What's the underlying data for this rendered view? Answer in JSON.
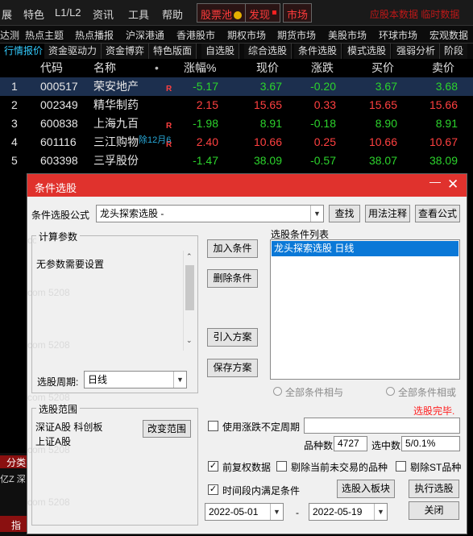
{
  "menubar": {
    "items": [
      "展",
      "特色",
      "L1/L2",
      "资讯",
      "工具",
      "帮助"
    ],
    "stock_pool": "股票池",
    "discover": "发现",
    "market": "市场",
    "marquee": "应股本数据 临时数据"
  },
  "navbar": {
    "items": [
      "达测",
      "热点主题",
      "热点播报",
      "沪深港通",
      "香港股市",
      "期权市场",
      "期货市场",
      "美股市场",
      "环球市场",
      "宏观数据"
    ]
  },
  "tabs": {
    "items": [
      "行情报价",
      "资金驱动力",
      "资金博弈",
      "特色版面",
      "自选股",
      "综合选股",
      "条件选股",
      "模式选股",
      "强弱分析",
      "阶段"
    ],
    "active": "行情报价"
  },
  "grid": {
    "headers": [
      "",
      "代码",
      "名称",
      "•",
      "涨幅%",
      "现价",
      "涨跌",
      "买价",
      "卖价"
    ],
    "rows": [
      {
        "idx": "1",
        "code": "000517",
        "name": "荣安地产",
        "flag": "R",
        "pct": "-5.17",
        "price": "3.67",
        "chg": "-0.20",
        "bid": "3.67",
        "ask": "3.68"
      },
      {
        "idx": "2",
        "code": "002349",
        "name": "精华制药",
        "flag": "",
        "pct": "2.15",
        "price": "15.65",
        "chg": "0.33",
        "bid": "15.65",
        "ask": "15.66"
      },
      {
        "idx": "3",
        "code": "600838",
        "name": "上海九百",
        "flag": "R",
        "pct": "-1.98",
        "price": "8.91",
        "chg": "-0.18",
        "bid": "8.90",
        "ask": "8.91"
      },
      {
        "idx": "4",
        "code": "601116",
        "name": "三江购物",
        "flag": "R",
        "pct": "2.40",
        "price": "10.66",
        "chg": "0.25",
        "bid": "10.66",
        "ask": "10.67"
      },
      {
        "idx": "5",
        "code": "603398",
        "name": "三孚股份",
        "flag": "",
        "pct": "-1.47",
        "price": "38.09",
        "chg": "-0.57",
        "bid": "38.07",
        "ask": "38.09"
      }
    ],
    "tooltip": "除12月6"
  },
  "dialog": {
    "title": "条件选股",
    "formula_label": "条件选股公式",
    "formula_value": "龙头探索选股 -",
    "find": "查找",
    "usage": "用法注释",
    "view_formula": "查看公式",
    "calc_params": "计算参数",
    "no_params": "无参数需要设置",
    "period_label": "选股周期:",
    "period_value": "日线",
    "add_cond": "加入条件",
    "del_cond": "删除条件",
    "import_plan": "引入方案",
    "save_plan": "保存方案",
    "cond_list_title": "选股条件列表",
    "cond_item": "龙头探索选股  日线",
    "all_and": "全部条件相与",
    "all_or": "全部条件相或",
    "done": "选股完毕.",
    "range_title": "选股范围",
    "range_value": "深证A股 科创板 上证A股",
    "change_range": "改变范围",
    "use_uncertain": "使用涨跌不定周期",
    "total_label": "品种数",
    "total_value": "4727",
    "hit_label": "选中数",
    "hit_value": "5/0.1%",
    "pre_adjust": "前复权数据",
    "exclude_untraded": "剔除当前未交易的品种",
    "exclude_st": "剔除ST品种",
    "time_range": "时间段内满足条件",
    "to_block": "选股入板块",
    "run": "执行选股",
    "date_from": "2022-05-01",
    "dash": "-",
    "date_to": "2022-05-19",
    "close": "关闭",
    "watermark": "com 5208"
  },
  "side": {
    "label1": "分类",
    "label2": "亿Z 深",
    "label3": "指"
  },
  "colors": {
    "up": "#ff4040",
    "down": "#2cd32c",
    "title_bar": "#e0322d",
    "selected": "#0a78d7"
  }
}
